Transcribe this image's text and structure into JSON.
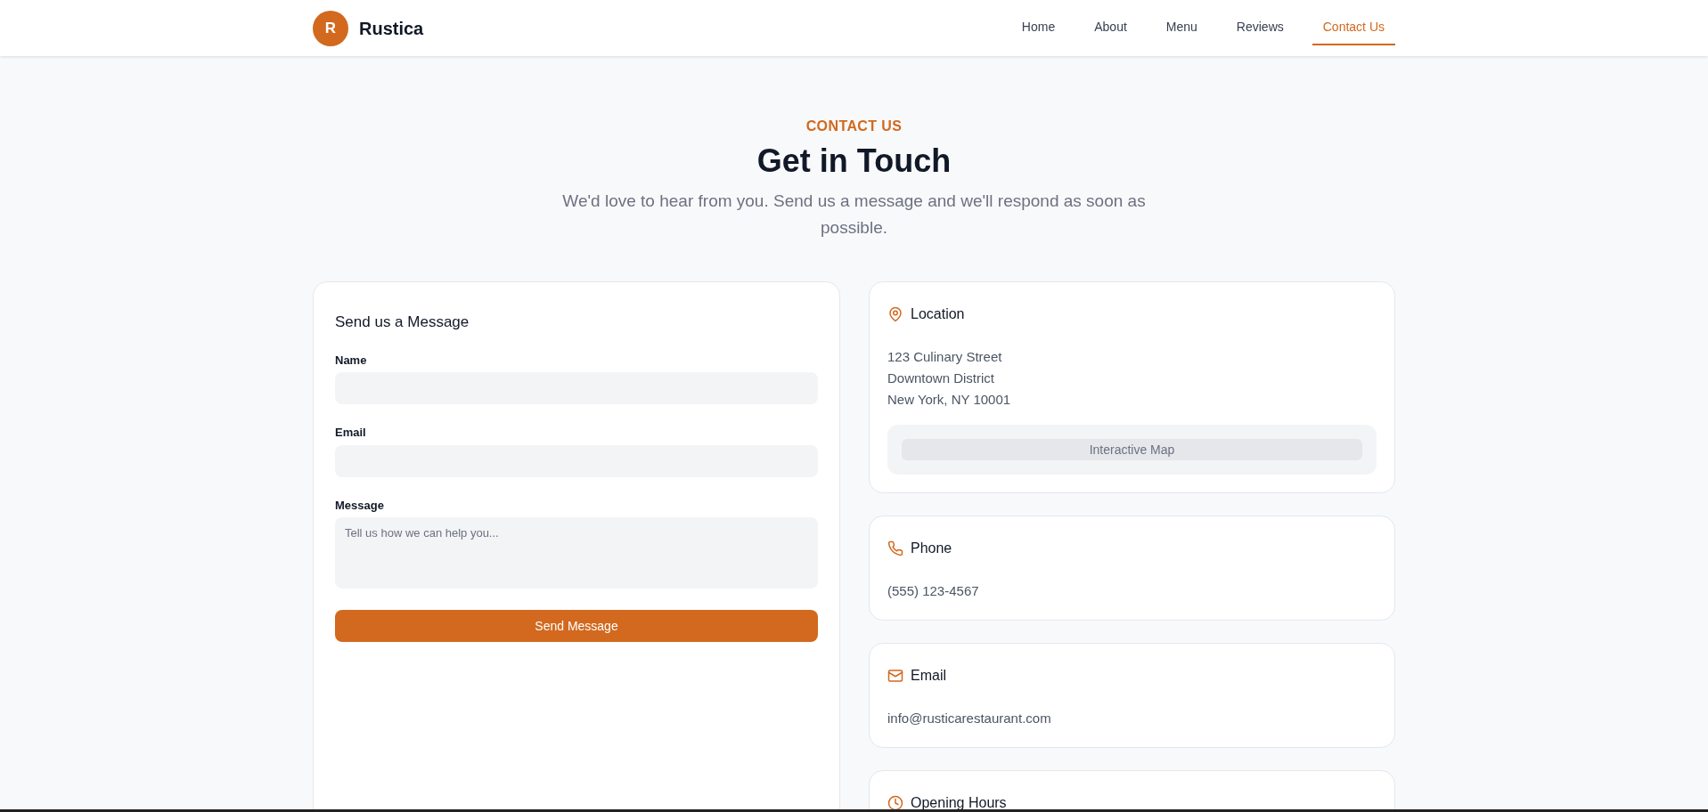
{
  "header": {
    "logo_letter": "R",
    "brand": "Rustica",
    "nav": [
      {
        "label": "Home",
        "selected": false
      },
      {
        "label": "About",
        "selected": false
      },
      {
        "label": "Menu",
        "selected": false
      },
      {
        "label": "Reviews",
        "selected": false
      },
      {
        "label": "Contact Us",
        "selected": true
      }
    ]
  },
  "hero": {
    "eyebrow": "CONTACT US",
    "title": "Get in Touch",
    "subtitle": "We'd love to hear from you. Send us a message and we'll respond as soon as possible."
  },
  "form": {
    "title": "Send us a Message",
    "fields": [
      {
        "kind": "input",
        "label": "Name"
      },
      {
        "kind": "input",
        "label": "Email"
      },
      {
        "kind": "textarea",
        "label": "Message",
        "placeholder": "Tell us how we can help you..."
      }
    ],
    "submit": "Send Message"
  },
  "info_cards": [
    {
      "kind": "location",
      "title": "Location",
      "lines": [
        "123 Culinary Street",
        "Downtown District",
        "New York, NY 10001"
      ],
      "map_label": "Interactive Map"
    },
    {
      "kind": "phone",
      "title": "Phone",
      "lines": [
        "(555) 123-4567"
      ]
    },
    {
      "kind": "email",
      "title": "Email",
      "lines": [
        "info@rusticarestaurant.com"
      ]
    },
    {
      "kind": "clock",
      "title": "Opening Hours"
    }
  ]
}
